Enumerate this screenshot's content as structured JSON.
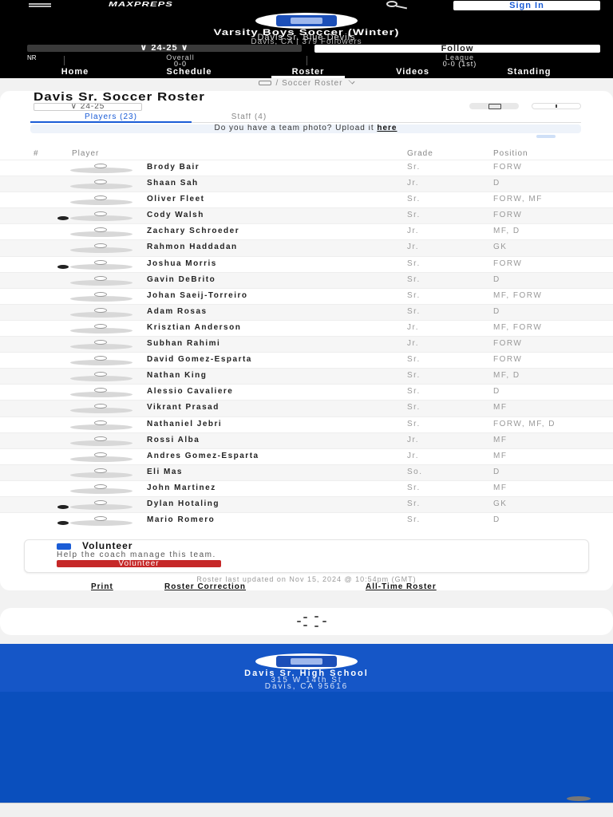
{
  "header": {
    "logo": "MAXPREPS",
    "signin_label": "Sign In",
    "team_title": "Varsity Boys Soccer (Winter)",
    "team_subtitle": "Davis Sr. Blue Devils",
    "team_location": "Davis, CA  |  379 Followers",
    "season_label": "24-25",
    "follow_label": "Follow",
    "rank_label": "NR",
    "stats": [
      {
        "label": "Overall",
        "value": "0-0"
      },
      {
        "label": "League",
        "value": "0-0 (1st)"
      }
    ],
    "nav": [
      "Home",
      "Schedule",
      "Roster",
      "Videos",
      "Standing"
    ]
  },
  "breadcrumb": {
    "label": "Soccer Roster"
  },
  "roster": {
    "title": "Davis Sr. Soccer Roster",
    "year_label": "24-25",
    "tabs": [
      "Players (23)",
      "Staff (4)"
    ],
    "photo_prompt": "Do you have a team photo? Upload it ",
    "photo_link": "here",
    "columns": {
      "number": "#",
      "player": "Player",
      "grade": "Grade",
      "position": "Position"
    },
    "players": [
      {
        "name": "Brody Bair",
        "grade": "Sr.",
        "position": "FORW",
        "captain": false
      },
      {
        "name": "Shaan Sah",
        "grade": "Jr.",
        "position": "D",
        "captain": false
      },
      {
        "name": "Oliver Fleet",
        "grade": "Sr.",
        "position": "FORW, MF",
        "captain": false
      },
      {
        "name": "Cody Walsh",
        "grade": "Sr.",
        "position": "FORW",
        "captain": true
      },
      {
        "name": "Zachary Schroeder",
        "grade": "Jr.",
        "position": "MF, D",
        "captain": false
      },
      {
        "name": "Rahmon Haddadan",
        "grade": "Jr.",
        "position": "GK",
        "captain": false
      },
      {
        "name": "Joshua Morris",
        "grade": "Sr.",
        "position": "FORW",
        "captain": true
      },
      {
        "name": "Gavin DeBrito",
        "grade": "Sr.",
        "position": "D",
        "captain": false
      },
      {
        "name": "Johan Saeij-Torreiro",
        "grade": "Sr.",
        "position": "MF, FORW",
        "captain": false
      },
      {
        "name": "Adam Rosas",
        "grade": "Sr.",
        "position": "D",
        "captain": false
      },
      {
        "name": "Krisztian Anderson",
        "grade": "Jr.",
        "position": "MF, FORW",
        "captain": false
      },
      {
        "name": "Subhan Rahimi",
        "grade": "Jr.",
        "position": "FORW",
        "captain": false
      },
      {
        "name": "David Gomez-Esparta",
        "grade": "Sr.",
        "position": "FORW",
        "captain": false
      },
      {
        "name": "Nathan King",
        "grade": "Sr.",
        "position": "MF, D",
        "captain": false
      },
      {
        "name": "Alessio Cavaliere",
        "grade": "Sr.",
        "position": "D",
        "captain": false
      },
      {
        "name": "Vikrant Prasad",
        "grade": "Sr.",
        "position": "MF",
        "captain": false
      },
      {
        "name": "Nathaniel Jebri",
        "grade": "Sr.",
        "position": "FORW, MF, D",
        "captain": false
      },
      {
        "name": "Rossi Alba",
        "grade": "Jr.",
        "position": "MF",
        "captain": false
      },
      {
        "name": "Andres Gomez-Esparta",
        "grade": "Jr.",
        "position": "MF",
        "captain": false
      },
      {
        "name": "Eli Mas",
        "grade": "So.",
        "position": "D",
        "captain": false
      },
      {
        "name": "John Martinez",
        "grade": "Sr.",
        "position": "MF",
        "captain": false
      },
      {
        "name": "Dylan Hotaling",
        "grade": "Sr.",
        "position": "GK",
        "captain": true
      },
      {
        "name": "Mario Romero",
        "grade": "Sr.",
        "position": "D",
        "captain": true
      }
    ],
    "volunteer": {
      "title": "Volunteer",
      "description": "Help the coach manage this team.",
      "button_label": "Volunteer"
    },
    "updated_text": "Roster last updated on Nov 15, 2024 @ 10:54pm (GMT)",
    "footer_links": [
      "Print",
      "Roster Correction",
      "All-Time Roster"
    ]
  },
  "school": {
    "name": "Davis Sr. High School",
    "street": "315 W 14th St",
    "city": "Davis, CA 95616"
  }
}
